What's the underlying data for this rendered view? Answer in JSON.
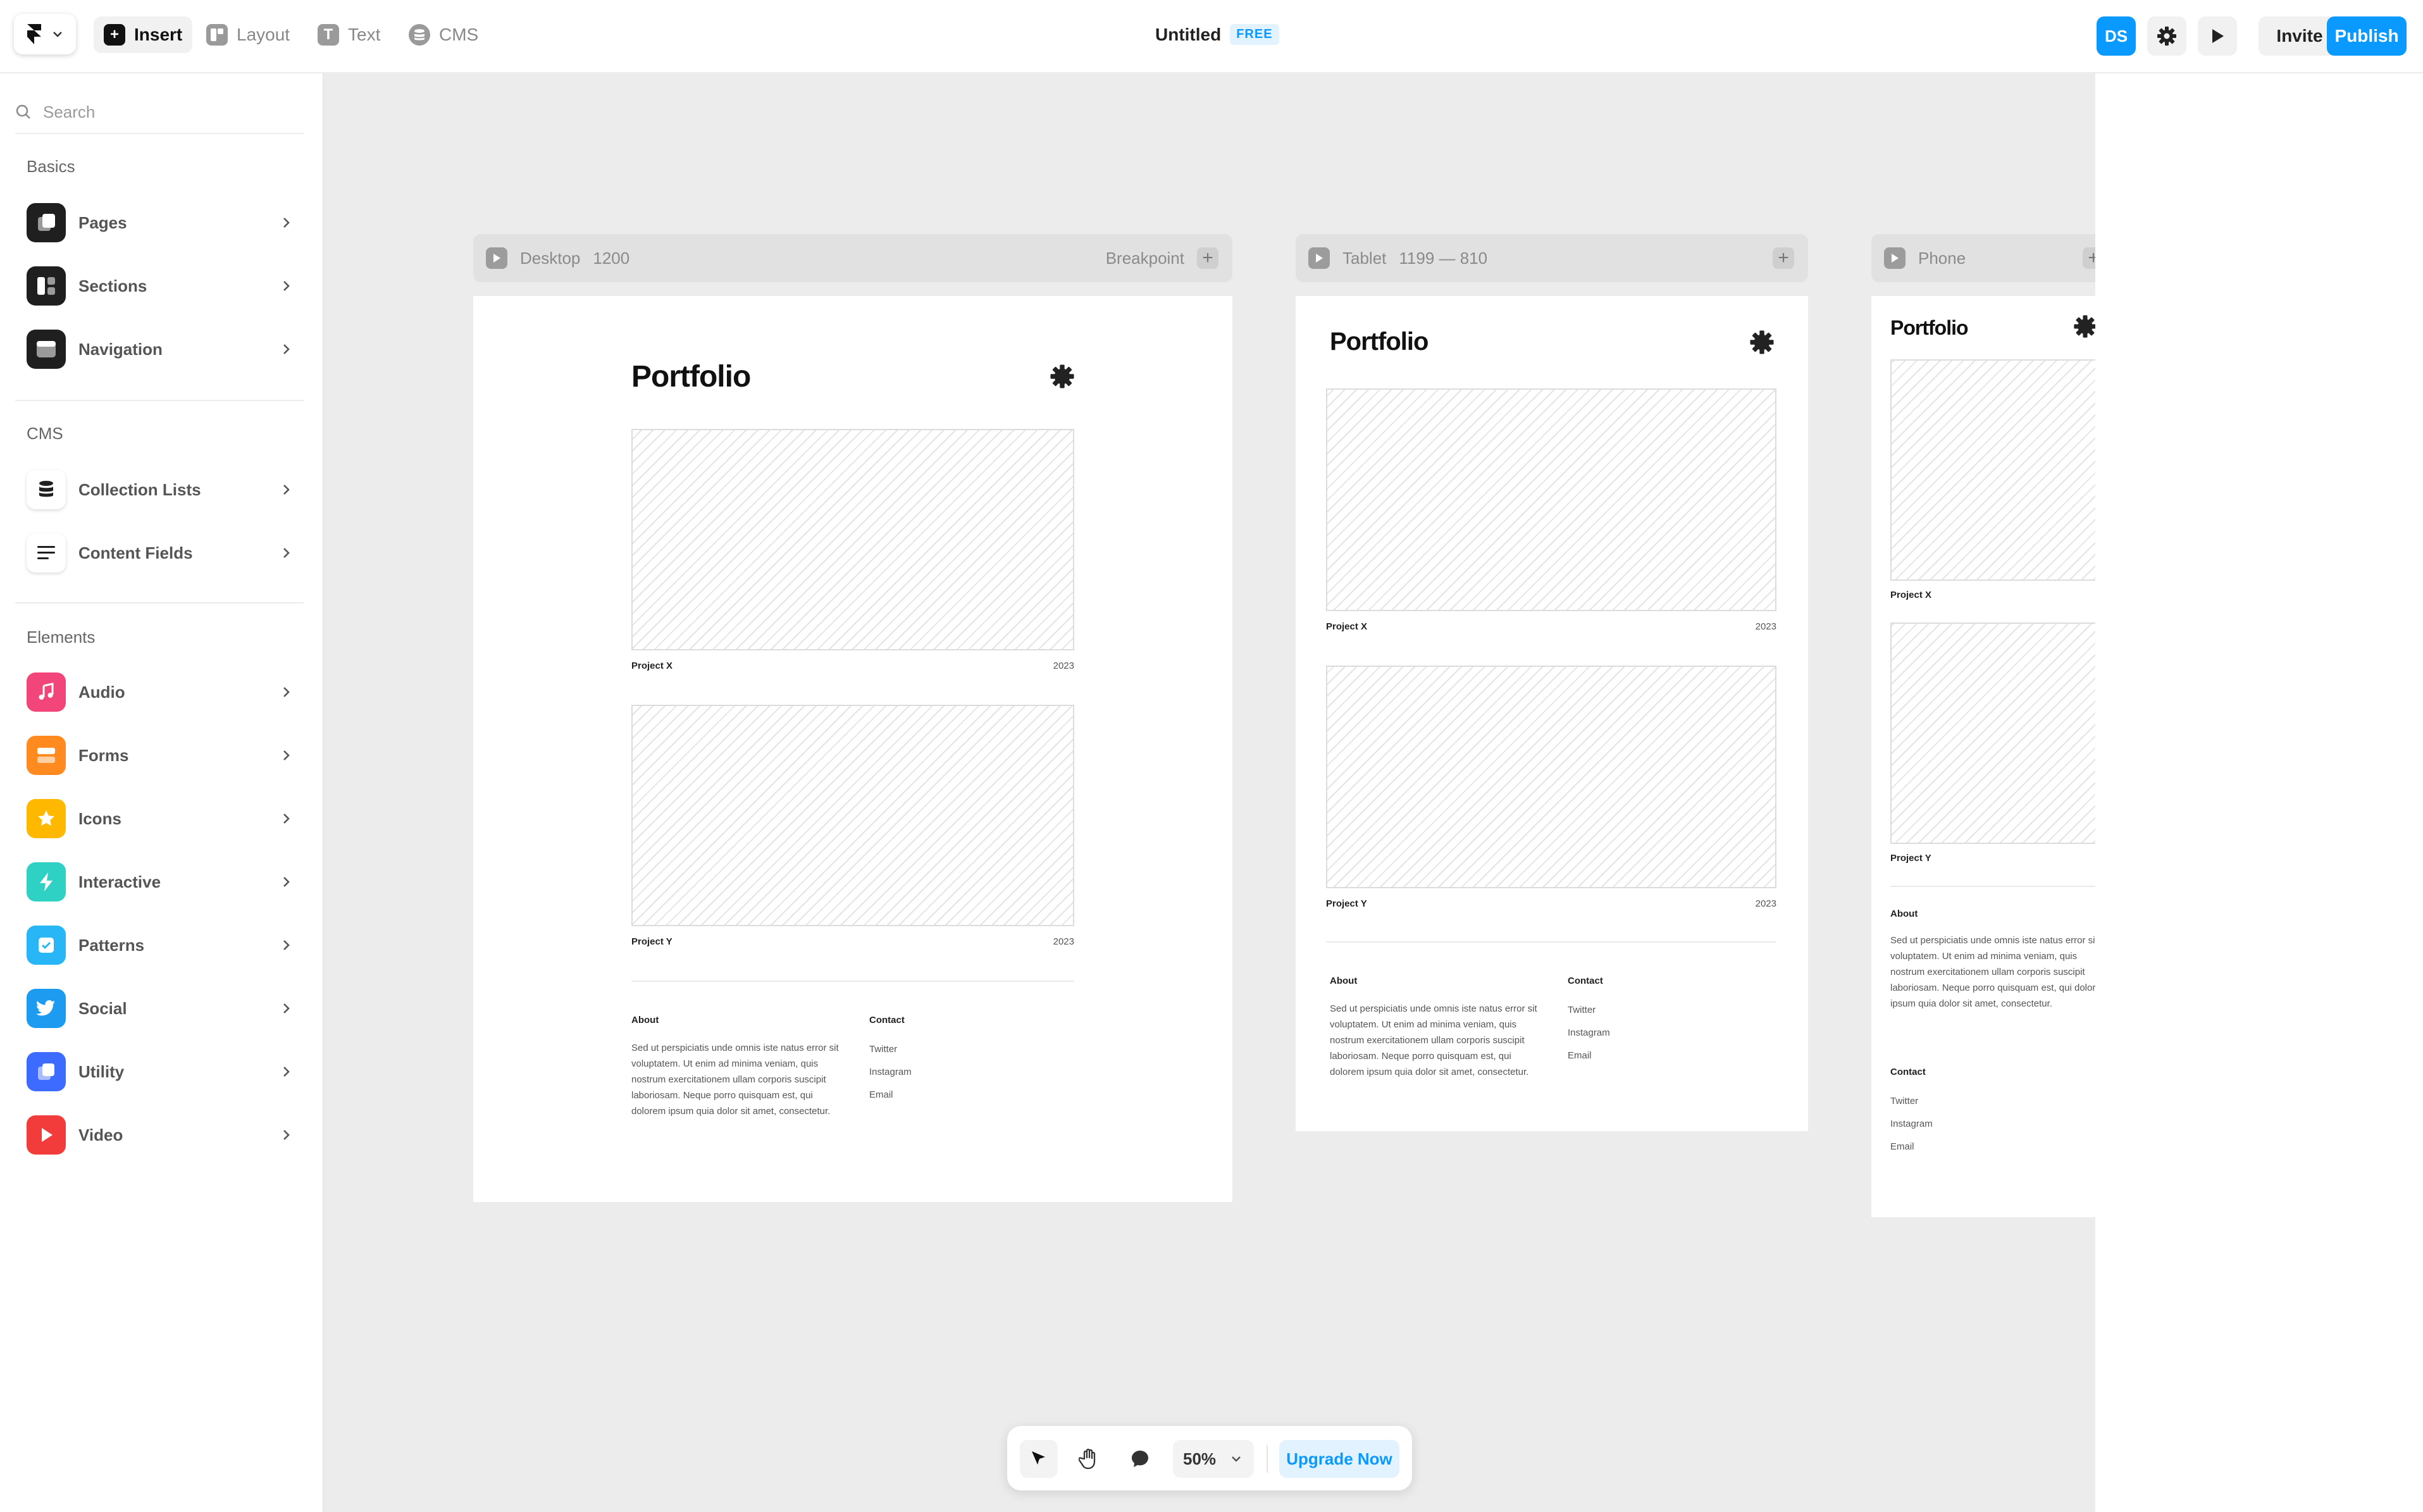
{
  "app": {
    "doc_title": "Untitled",
    "plan_badge": "FREE",
    "user_initials": "DS",
    "invite_label": "Invite",
    "publish_label": "Publish",
    "accent": "#0a99ff"
  },
  "toolbar": {
    "tools": [
      {
        "label": "Insert",
        "icon": "plus-icon"
      },
      {
        "label": "Layout",
        "icon": "layout-icon"
      },
      {
        "label": "Text",
        "icon": "text-icon"
      },
      {
        "label": "CMS",
        "icon": "database-icon"
      }
    ]
  },
  "sidebar": {
    "search_placeholder": "Search",
    "sections": [
      {
        "title": "Basics",
        "items": [
          {
            "label": "Pages",
            "icon": "pages-icon",
            "color": "#1f1f1f"
          },
          {
            "label": "Sections",
            "icon": "sections-icon",
            "color": "#1f1f1f"
          },
          {
            "label": "Navigation",
            "icon": "navigation-icon",
            "color": "#1f1f1f"
          }
        ]
      },
      {
        "title": "CMS",
        "items": [
          {
            "label": "Collection Lists",
            "icon": "database-icon",
            "color": "#ffffff"
          },
          {
            "label": "Content Fields",
            "icon": "lines-icon",
            "color": "#ffffff"
          }
        ]
      },
      {
        "title": "Elements",
        "items": [
          {
            "label": "Audio",
            "icon": "music-icon",
            "color": "#f2467b"
          },
          {
            "label": "Forms",
            "icon": "form-icon",
            "color": "#ff8a1f"
          },
          {
            "label": "Icons",
            "icon": "star-icon",
            "color": "#ffb800"
          },
          {
            "label": "Interactive",
            "icon": "bolt-icon",
            "color": "#2ed1c4"
          },
          {
            "label": "Patterns",
            "icon": "check-square-icon",
            "color": "#29b6f6"
          },
          {
            "label": "Social",
            "icon": "twitter-icon",
            "color": "#1d9bf0"
          },
          {
            "label": "Utility",
            "icon": "copy-icon",
            "color": "#3d6bff"
          },
          {
            "label": "Video",
            "icon": "play-icon",
            "color": "#f23b3b"
          }
        ]
      }
    ]
  },
  "canvas": {
    "breakpoints": [
      {
        "name": "Desktop",
        "size": "1200",
        "extra": "Breakpoint"
      },
      {
        "name": "Tablet",
        "size": "1199 — 810",
        "extra": ""
      },
      {
        "name": "Phone",
        "size": "",
        "extra": ""
      }
    ],
    "site": {
      "title": "Portfolio",
      "projects": [
        {
          "name": "Project X",
          "year": "2023"
        },
        {
          "name": "Project Y",
          "year": "2023"
        }
      ],
      "about_heading": "About",
      "about_text": "Sed ut perspiciatis unde omnis iste natus error sit voluptatem. Ut enim ad minima veniam, quis nostrum exercitationem ullam corporis suscipit laboriosam. Neque porro quisquam est, qui dolorem ipsum quia dolor sit amet, consectetur.",
      "contact_heading": "Contact",
      "contact_links": [
        "Twitter",
        "Instagram",
        "Email"
      ]
    }
  },
  "bottombar": {
    "zoom": "50%",
    "upgrade_label": "Upgrade Now"
  }
}
